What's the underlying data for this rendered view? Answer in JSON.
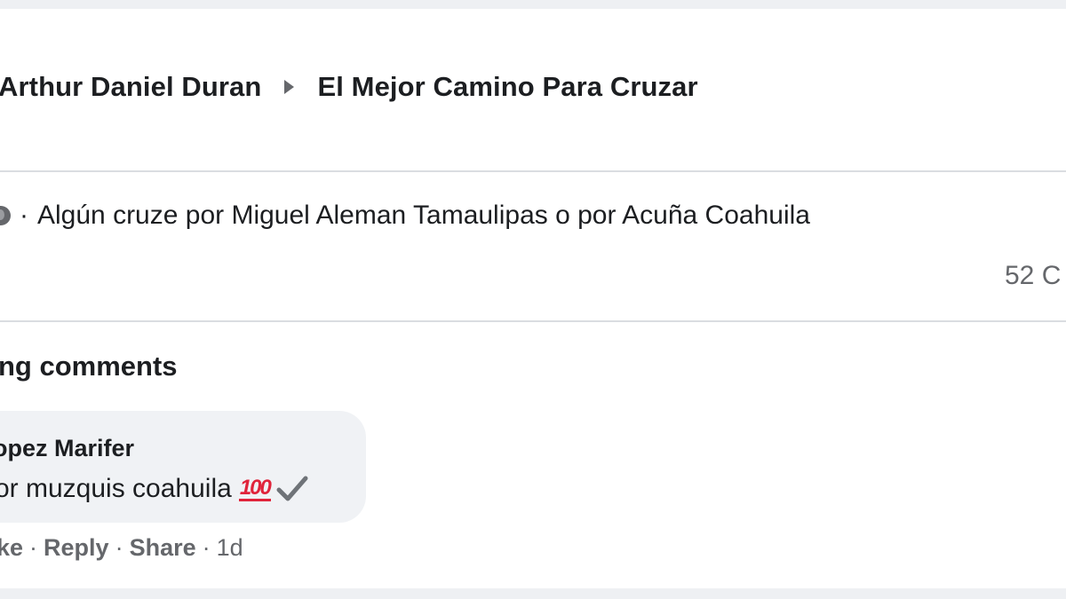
{
  "breadcrumb": {
    "author": "Arthur Daniel Duran",
    "group": "El Mejor Camino Para Cruzar"
  },
  "post": {
    "separator": "·",
    "text": "Algún cruze por Miguel Aleman Tamaulipas o por Acuña Coahuila",
    "comment_count": "52 C"
  },
  "comments_section": {
    "title": "ng comments",
    "comment": {
      "author": "opez Marifer",
      "text": "or muzquis coahuila",
      "emoji_100": "100",
      "actions": {
        "like": "ke",
        "reply": "Reply",
        "share": "Share",
        "dot": "·",
        "time": "1d"
      }
    }
  },
  "icons": {
    "audience": "globe-icon",
    "breadcrumb_separator": "caret-right-icon",
    "emoji_check": "check-mark-icon",
    "emoji_hundred": "hundred-points-icon"
  },
  "colors": {
    "text": "#1c1e21",
    "secondary": "#65676b",
    "bubble": "#f0f2f5",
    "divider": "#dadde1",
    "emoji_red": "#e0243b"
  }
}
